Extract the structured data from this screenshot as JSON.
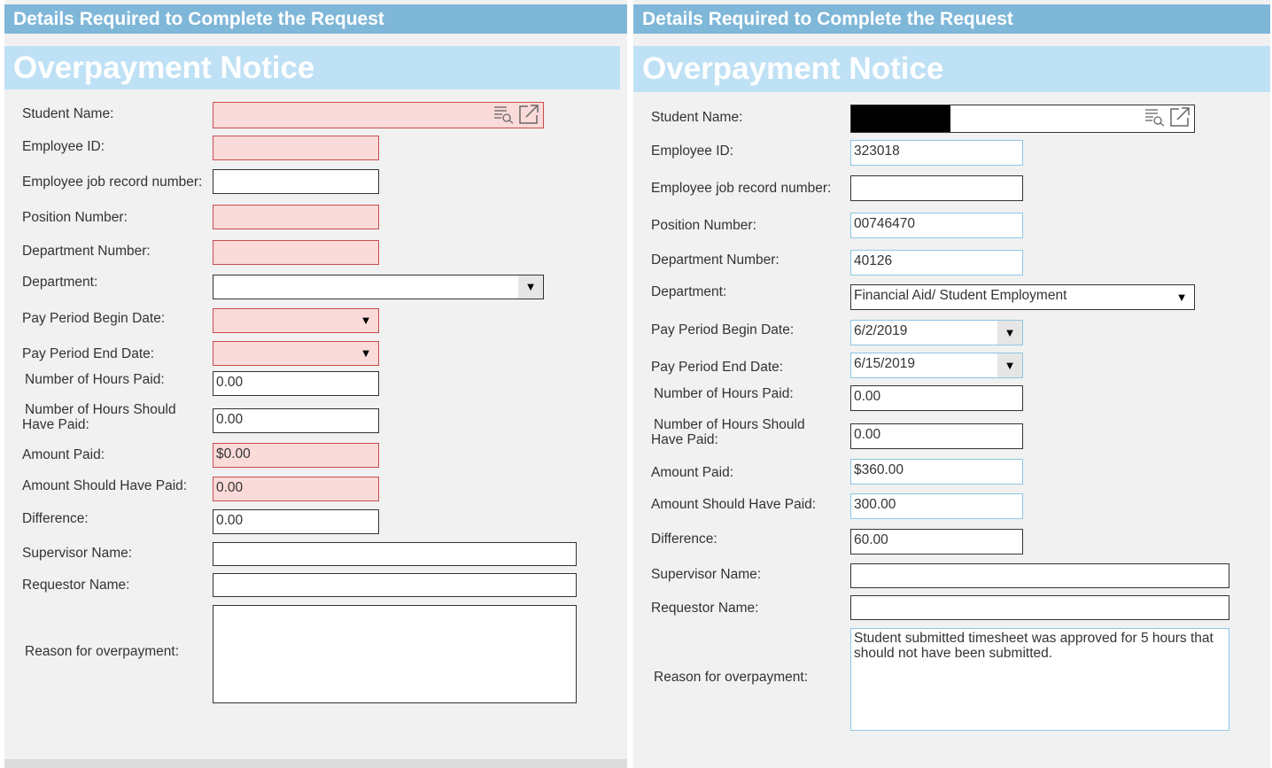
{
  "colors": {
    "header_bar": "#7fb7d9",
    "title_bar": "#bfe1f5",
    "required_fill": "#fbdada",
    "required_border": "#c94d4d"
  },
  "header_text": "Details Required to Complete the Request",
  "form_title": "Overpayment Notice",
  "labels": {
    "student_name": "Student Name:",
    "employee_id": "Employee ID:",
    "job_record": "Employee job record number:",
    "position_number": "Position Number:",
    "department_number": "Department Number:",
    "department": "Department:",
    "pay_begin": "Pay Period Begin Date:",
    "pay_end": "Pay Period End Date:",
    "hours_paid": "Number of Hours Paid:",
    "hours_should": "Number of Hours Should Have Paid:",
    "amount_paid": "Amount Paid:",
    "amount_should": "Amount Should Have Paid:",
    "difference": "Difference:",
    "supervisor": "Supervisor Name:",
    "requestor": "Requestor Name:",
    "reason": "Reason for overpayment:"
  },
  "icons": {
    "lookup": "list-search-icon",
    "open": "open-external-icon",
    "dropdown": "chevron-down-icon"
  },
  "left_form": {
    "student_name": "",
    "employee_id": "",
    "job_record": "",
    "position_number": "",
    "department_number": "",
    "department": "",
    "pay_begin": "",
    "pay_end": "",
    "hours_paid": "0.00",
    "hours_should": "0.00",
    "amount_paid": "$0.00",
    "amount_should": "0.00",
    "difference": "0.00",
    "supervisor": "",
    "requestor": "",
    "reason": ""
  },
  "right_form": {
    "student_name": "",
    "employee_id": "323018",
    "job_record": "",
    "position_number": "00746470",
    "department_number": "40126",
    "department": "Financial Aid/ Student Employment",
    "pay_begin": "6/2/2019",
    "pay_end": "6/15/2019",
    "hours_paid": "0.00",
    "hours_should": "0.00",
    "amount_paid": "$360.00",
    "amount_should": "300.00",
    "difference": "60.00",
    "supervisor": "",
    "requestor": "",
    "reason": "Student submitted timesheet was approved for 5 hours that should not have been submitted."
  }
}
